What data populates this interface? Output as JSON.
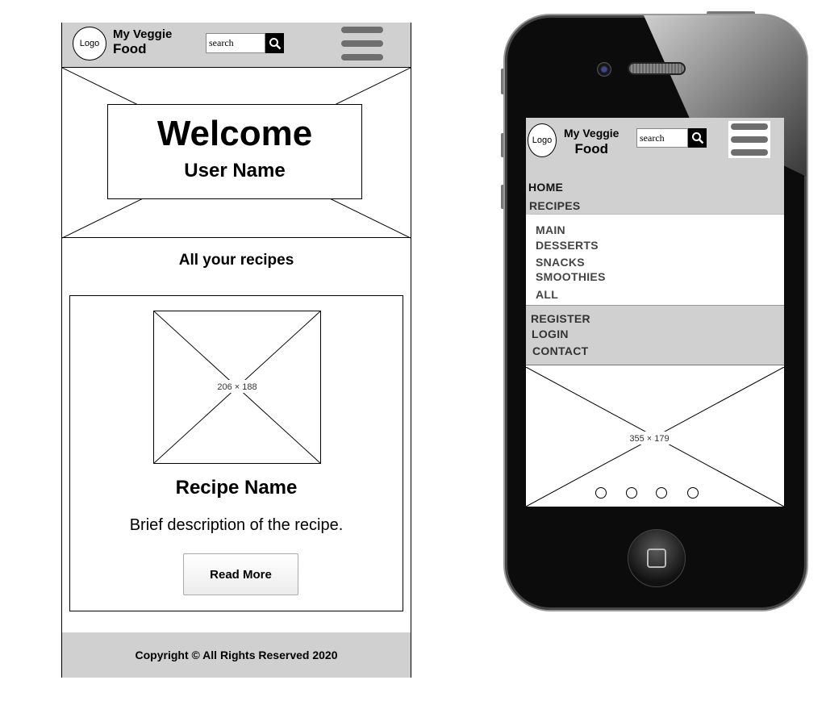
{
  "desktop": {
    "header": {
      "logo_text": "Logo",
      "brand_line1": "My Veggie",
      "brand_line2": "Food",
      "search_placeholder": "search",
      "search_icon": "search-icon",
      "menu_icon": "hamburger-menu-icon"
    },
    "hero": {
      "title": "Welcome",
      "subtitle": "User Name"
    },
    "section_title": "All your recipes",
    "recipe_card": {
      "image_placeholder": "206 × 188",
      "name": "Recipe Name",
      "description": "Brief description of the recipe.",
      "button_label": "Read More"
    },
    "footer": {
      "text": "Copyright © All Rights Reserved 2020"
    }
  },
  "mobile": {
    "header": {
      "logo_text": "Logo",
      "brand_line1": "My Veggie",
      "brand_line2": "Food",
      "search_placeholder": "search",
      "search_icon": "search-icon",
      "menu_icon": "hamburger-menu-icon"
    },
    "nav": {
      "home": "HOME",
      "recipes": "RECIPES",
      "submenu": [
        "MAIN",
        "DESSERTS",
        "SNACKS",
        "SMOOTHIES",
        "ALL"
      ],
      "register": "REGISTER",
      "login": "LOGIN",
      "contact": "CONTACT"
    },
    "slider": {
      "image_placeholder": "355 × 179",
      "dot_count": 4
    }
  },
  "colors": {
    "header_gray": "#d0d0d0",
    "hamburger_gray": "#6e6e6e",
    "phone_body": "#0c0c0c"
  }
}
